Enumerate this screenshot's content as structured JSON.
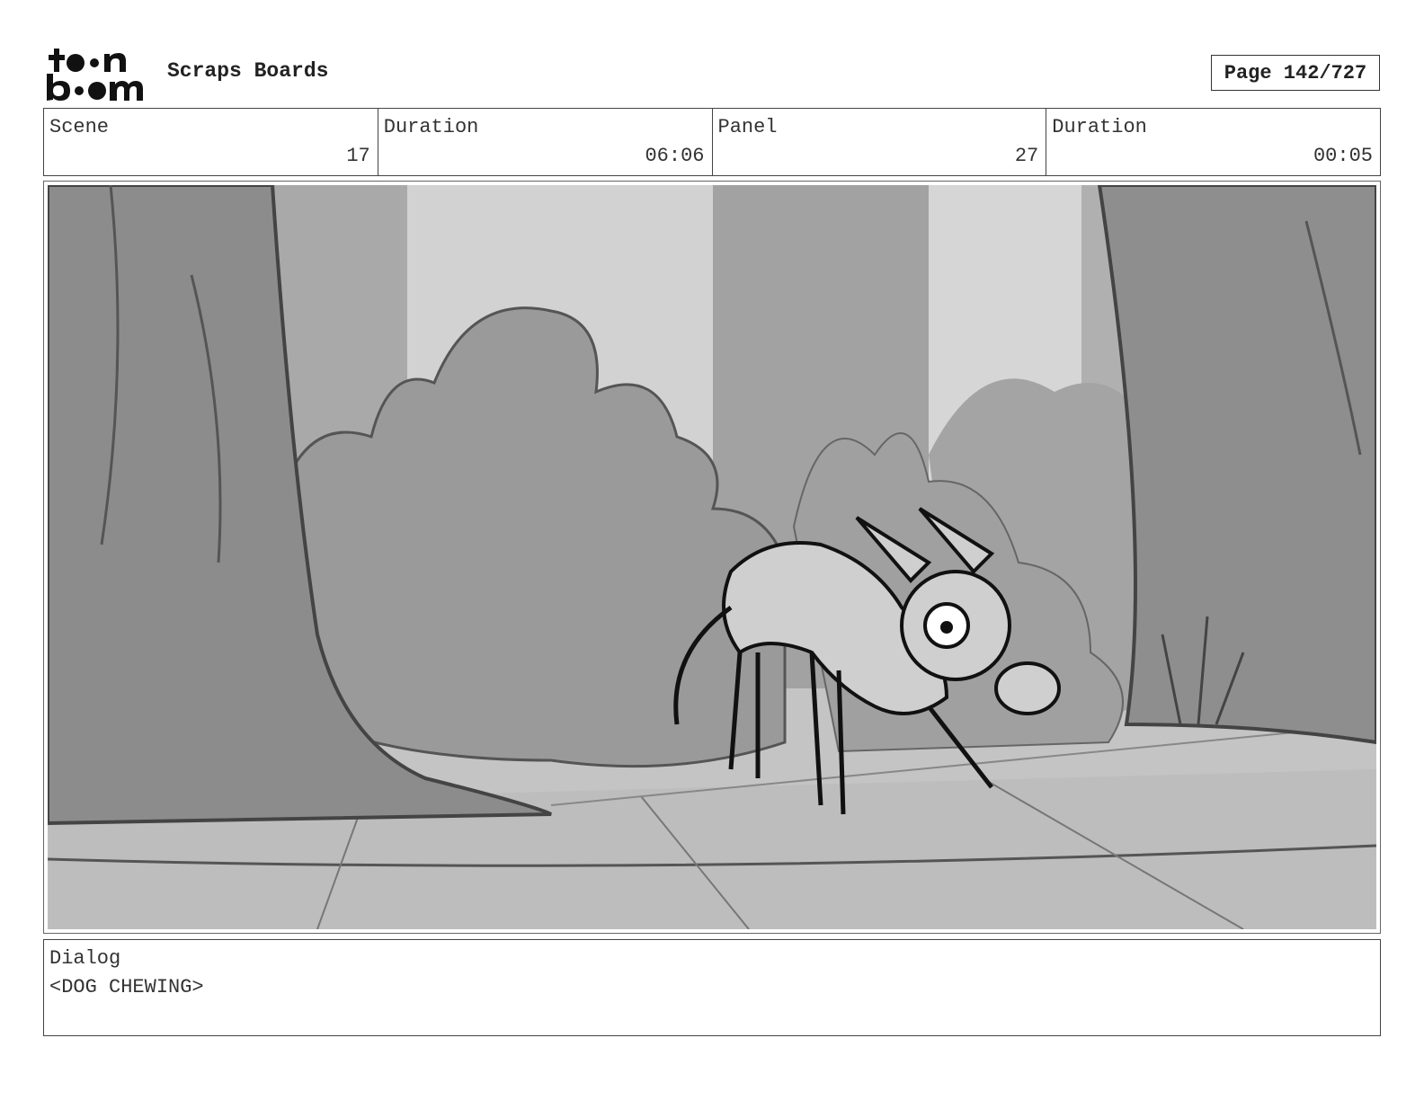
{
  "header": {
    "logo_line1": "toon",
    "logo_line2": "boom",
    "title": "Scraps Boards",
    "page": "Page 142/727"
  },
  "info": [
    {
      "label": "Scene",
      "value": "17"
    },
    {
      "label": "Duration",
      "value": "06:06"
    },
    {
      "label": "Panel",
      "value": "27"
    },
    {
      "label": "Duration",
      "value": "00:05"
    }
  ],
  "panel": {
    "image_icon": "storyboard-sketch-dog-in-forest"
  },
  "dialog": {
    "label": "Dialog",
    "text": "<DOG CHEWING>"
  }
}
